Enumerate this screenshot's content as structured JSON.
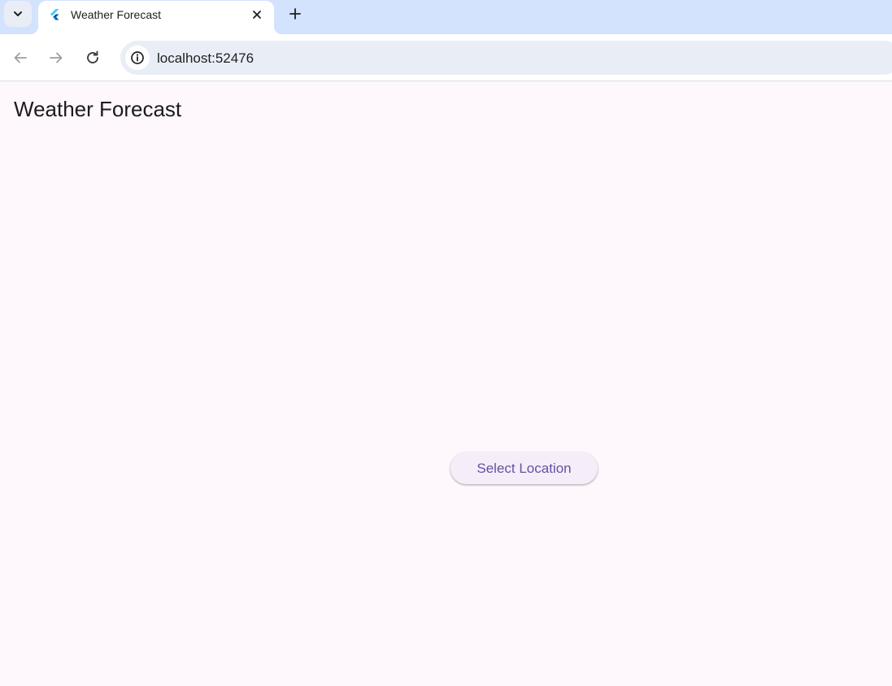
{
  "browser": {
    "tab": {
      "title": "Weather Forecast",
      "favicon": "flutter-logo"
    },
    "address_bar": {
      "url": "localhost:52476"
    },
    "icons": {
      "tab_search": "chevron-down-icon",
      "close_tab": "close-icon",
      "new_tab": "plus-icon",
      "back": "arrow-left-icon",
      "forward": "arrow-right-icon",
      "reload": "reload-icon",
      "site_info": "info-icon"
    }
  },
  "app": {
    "title": "Weather Forecast",
    "select_location_label": "Select Location"
  },
  "colors": {
    "page_background": "#fef7fb",
    "button_text": "#6750a4",
    "button_background": "#f5eef8",
    "tabstrip": "#d3e3fd"
  }
}
